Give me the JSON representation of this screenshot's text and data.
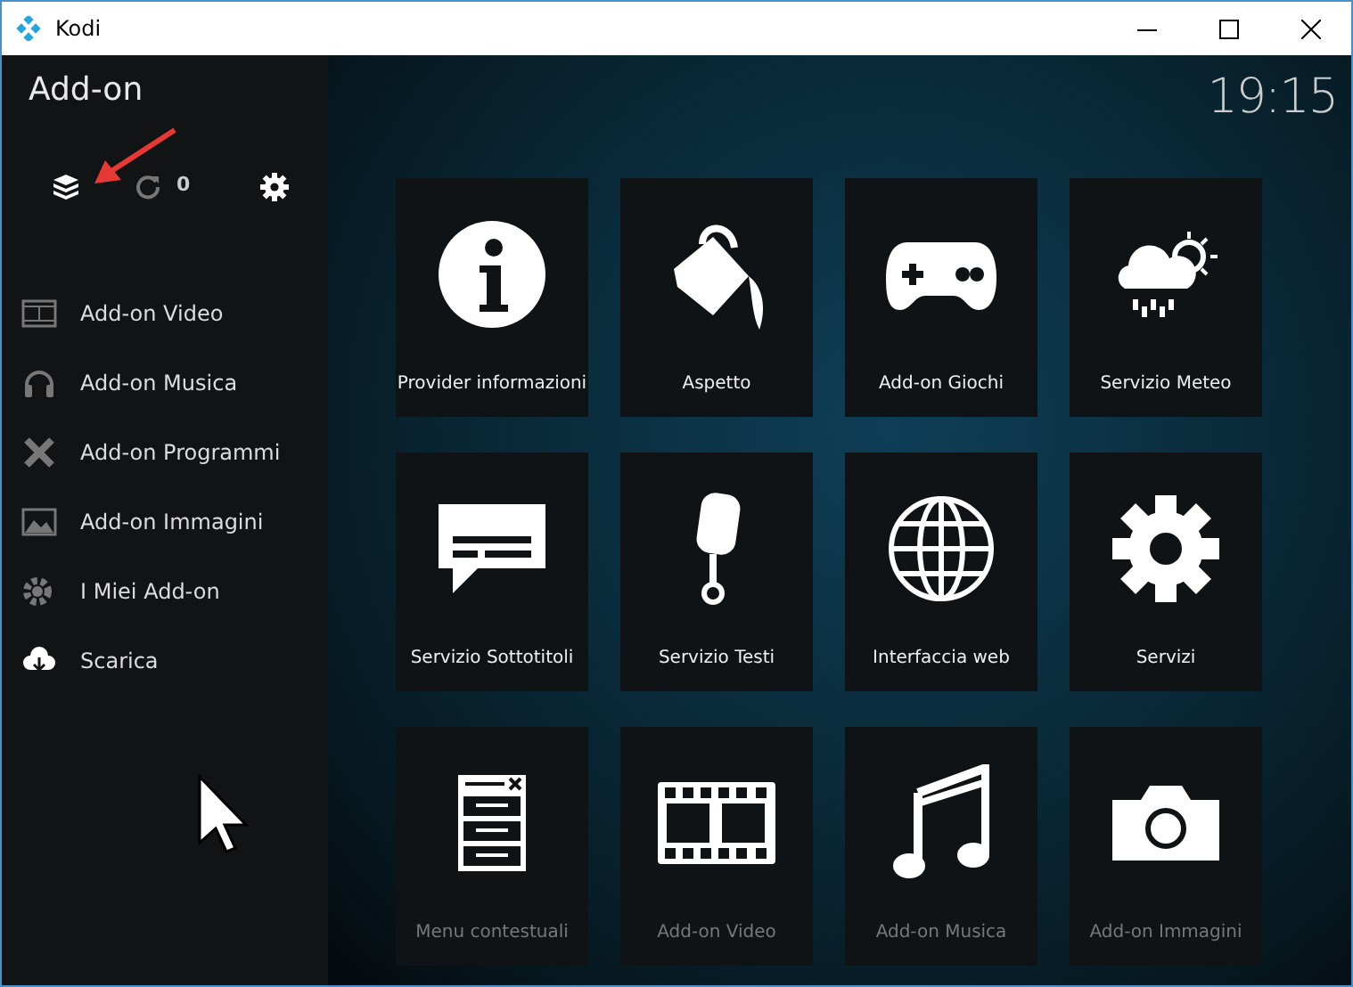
{
  "window": {
    "title": "Kodi"
  },
  "header": {
    "title": "Add-on",
    "clock": "19:15"
  },
  "toolbar": {
    "update_count": "0"
  },
  "sidebar": {
    "items": [
      {
        "label": "Add-on Video"
      },
      {
        "label": "Add-on Musica"
      },
      {
        "label": "Add-on Programmi"
      },
      {
        "label": "Add-on Immagini"
      },
      {
        "label": "I Miei Add-on"
      },
      {
        "label": "Scarica"
      }
    ]
  },
  "tiles": [
    {
      "label": "Provider informazioni"
    },
    {
      "label": "Aspetto"
    },
    {
      "label": "Add-on Giochi"
    },
    {
      "label": "Servizio Meteo"
    },
    {
      "label": "Servizio Sottotitoli"
    },
    {
      "label": "Servizio Testi"
    },
    {
      "label": "Interfaccia web"
    },
    {
      "label": "Servizi"
    },
    {
      "label": "Menu contestuali"
    },
    {
      "label": "Add-on Video"
    },
    {
      "label": "Add-on Musica"
    },
    {
      "label": "Add-on Immagini"
    }
  ]
}
